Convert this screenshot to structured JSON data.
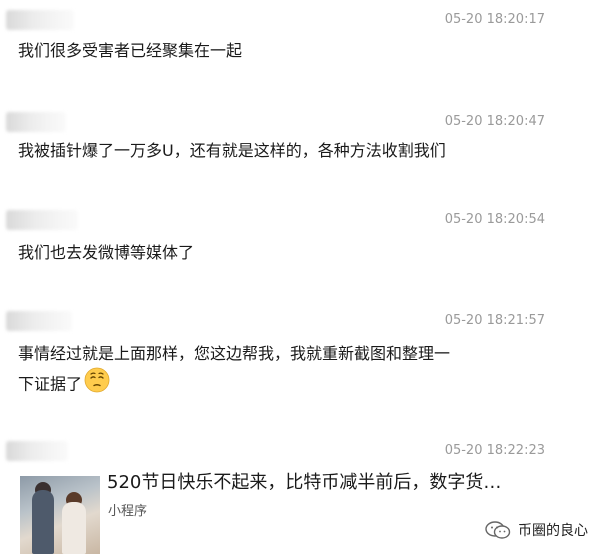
{
  "messages": [
    {
      "time": "05-20 18:20:17",
      "text": [
        "我们很多受害者已经聚集在一起"
      ]
    },
    {
      "time": "05-20 18:20:47",
      "text": [
        "我被插针爆了一万多U，还有就是这样的，各种方法收割我们"
      ]
    },
    {
      "time": "05-20 18:20:54",
      "text": [
        "我们也去发微博等媒体了"
      ]
    },
    {
      "time": "05-20 18:21:57",
      "text": [
        "事情经过就是上面那样，您这边帮我，我就重新截图和整理一",
        "下证据了"
      ],
      "emoji": "pensive-face-emoji"
    },
    {
      "time": "05-20 18:22:23"
    }
  ],
  "mini_program_card": {
    "title": "520节日快乐不起来，比特币减半前后，数字货…",
    "subtitle": "小程序",
    "thumbnail": "couple-photo-thumbnail"
  },
  "watermark": {
    "text": "币圈的良心",
    "icon": "wechat-icon"
  },
  "colors": {
    "timestamp": "#9a9a9a",
    "text": "#1a1a1a",
    "subtitle": "#555555"
  }
}
